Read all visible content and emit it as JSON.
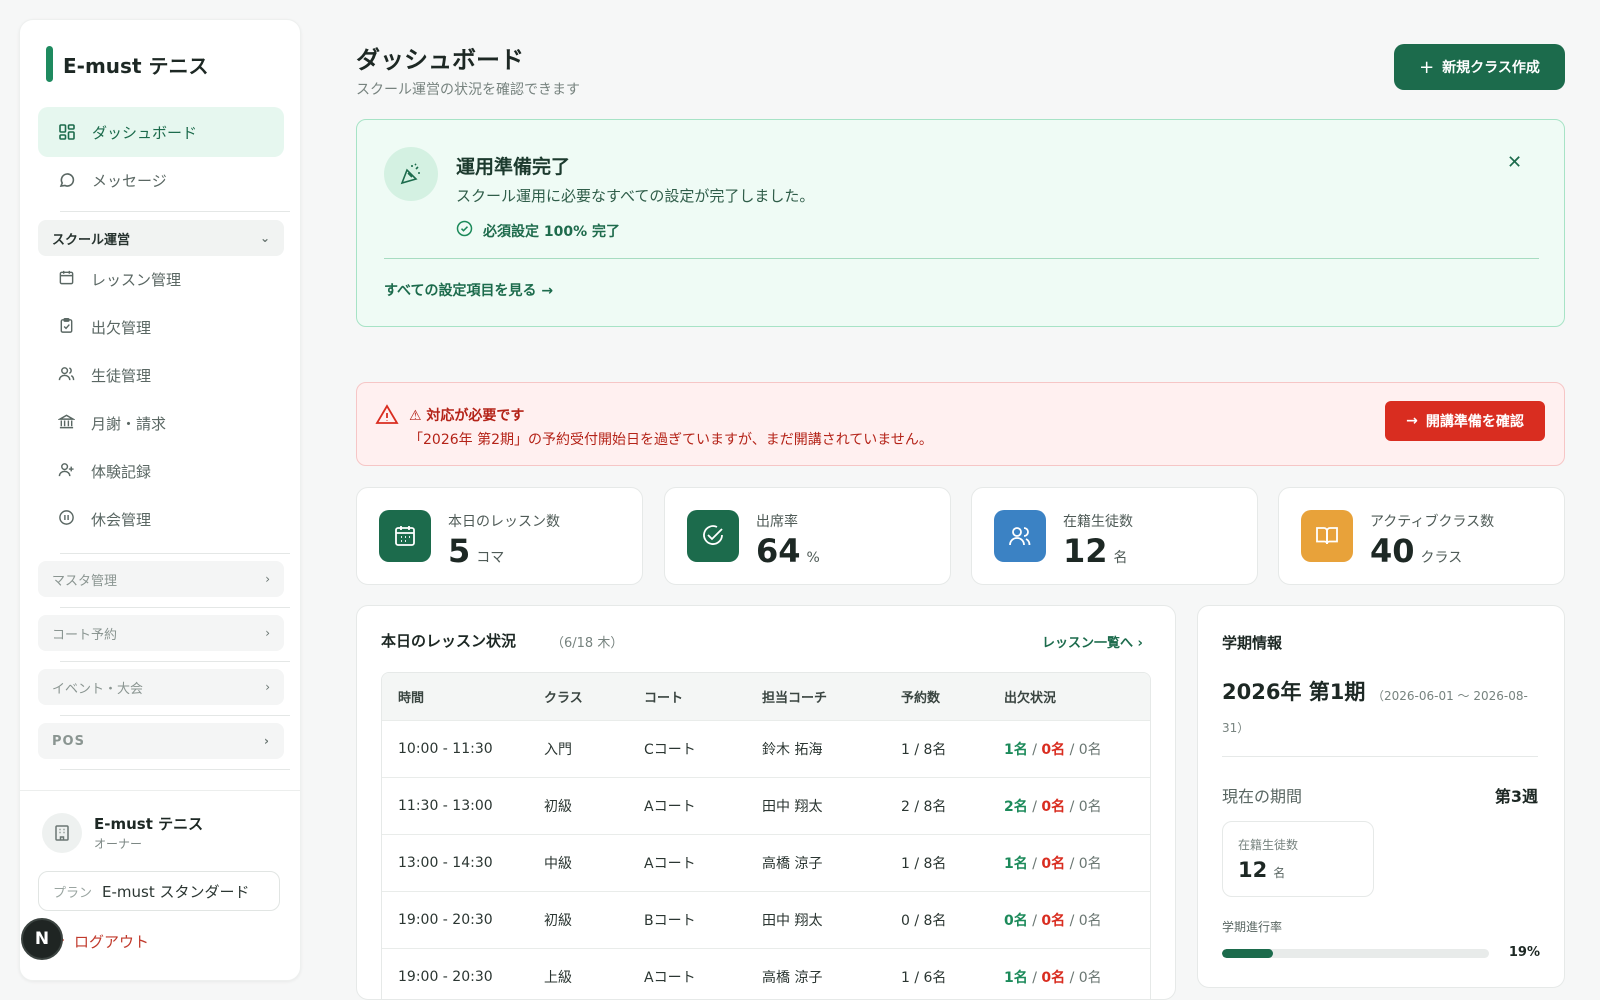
{
  "brand": {
    "name": "E-must テニス",
    "accent": "#1e8a5f"
  },
  "nav": {
    "dashboard": "ダッシュボード",
    "messages": "メッセージ",
    "school_ops": "スクール運営",
    "sub": [
      "レッスン管理",
      "出欠管理",
      "生徒管理",
      "月謝・請求",
      "体験記録",
      "休会管理"
    ],
    "master": "マスタ管理",
    "court": "コート予約",
    "events": "イベント・大会",
    "pos": "POS"
  },
  "footer": {
    "org_name": "E-must テニス",
    "org_role": "オーナー",
    "plan_label": "プラン",
    "plan_value": "E-must スタンダード",
    "logout": "ログアウト",
    "badge": "N"
  },
  "header": {
    "title": "ダッシュボード",
    "subtitle": "スクール運営の状況を確認できます",
    "new_button": "新規クラス作成"
  },
  "ready": {
    "title": "運用準備完了",
    "desc": "スクール運用に必要なすべての設定が完了しました。",
    "check": "必須設定 100% 完了",
    "link": "すべての設定項目を見る →"
  },
  "alert": {
    "title": "⚠ 対応が必要です",
    "desc": "「2026年 第2期」の予約受付開始日を過ぎていますが、まだ開講されていません。",
    "button": "開講準備を確認"
  },
  "stats": [
    {
      "label": "本日のレッスン数",
      "value": "5",
      "unit": "コマ",
      "color": "#1c6b4c"
    },
    {
      "label": "出席率",
      "value": "64",
      "unit": "%",
      "color": "#1c6b4c"
    },
    {
      "label": "在籍生徒数",
      "value": "12",
      "unit": "名",
      "color": "#3b82c4"
    },
    {
      "label": "アクティブクラス数",
      "value": "40",
      "unit": "クラス",
      "color": "#e8a23a"
    }
  ],
  "lessons": {
    "title": "本日のレッスン状況",
    "date": "（6/18 木）",
    "link": "レッスン一覧へ ›",
    "headers": [
      "時間",
      "クラス",
      "コート",
      "担当コーチ",
      "予約数",
      "出欠状況"
    ],
    "rows": [
      {
        "time": "10:00 - 11:30",
        "cls": "入門",
        "court": "Cコート",
        "coach": "鈴木 拓海",
        "reserved": "1 / 8名",
        "present": "1名",
        "absent": "0名",
        "other": "0名"
      },
      {
        "time": "11:30 - 13:00",
        "cls": "初級",
        "court": "Aコート",
        "coach": "田中 翔太",
        "reserved": "2 / 8名",
        "present": "2名",
        "absent": "0名",
        "other": "0名"
      },
      {
        "time": "13:00 - 14:30",
        "cls": "中級",
        "court": "Aコート",
        "coach": "高橋 涼子",
        "reserved": "1 / 8名",
        "present": "1名",
        "absent": "0名",
        "other": "0名"
      },
      {
        "time": "19:00 - 20:30",
        "cls": "初級",
        "court": "Bコート",
        "coach": "田中 翔太",
        "reserved": "0 / 8名",
        "present": "0名",
        "absent": "0名",
        "other": "0名"
      },
      {
        "time": "19:00 - 20:30",
        "cls": "上級",
        "court": "Aコート",
        "coach": "高橋 涼子",
        "reserved": "1 / 6名",
        "present": "1名",
        "absent": "0名",
        "other": "0名"
      }
    ]
  },
  "term": {
    "title": "学期情報",
    "name": "2026年 第1期",
    "range": "（2026-06-01 〜 2026-08-31）",
    "current_label": "現在の期間",
    "current_value": "第3週",
    "students_label": "在籍生徒数",
    "students_value": "12",
    "students_unit": "名",
    "progress_label": "学期進行率",
    "progress_text": "19%",
    "progress": 0.19
  }
}
